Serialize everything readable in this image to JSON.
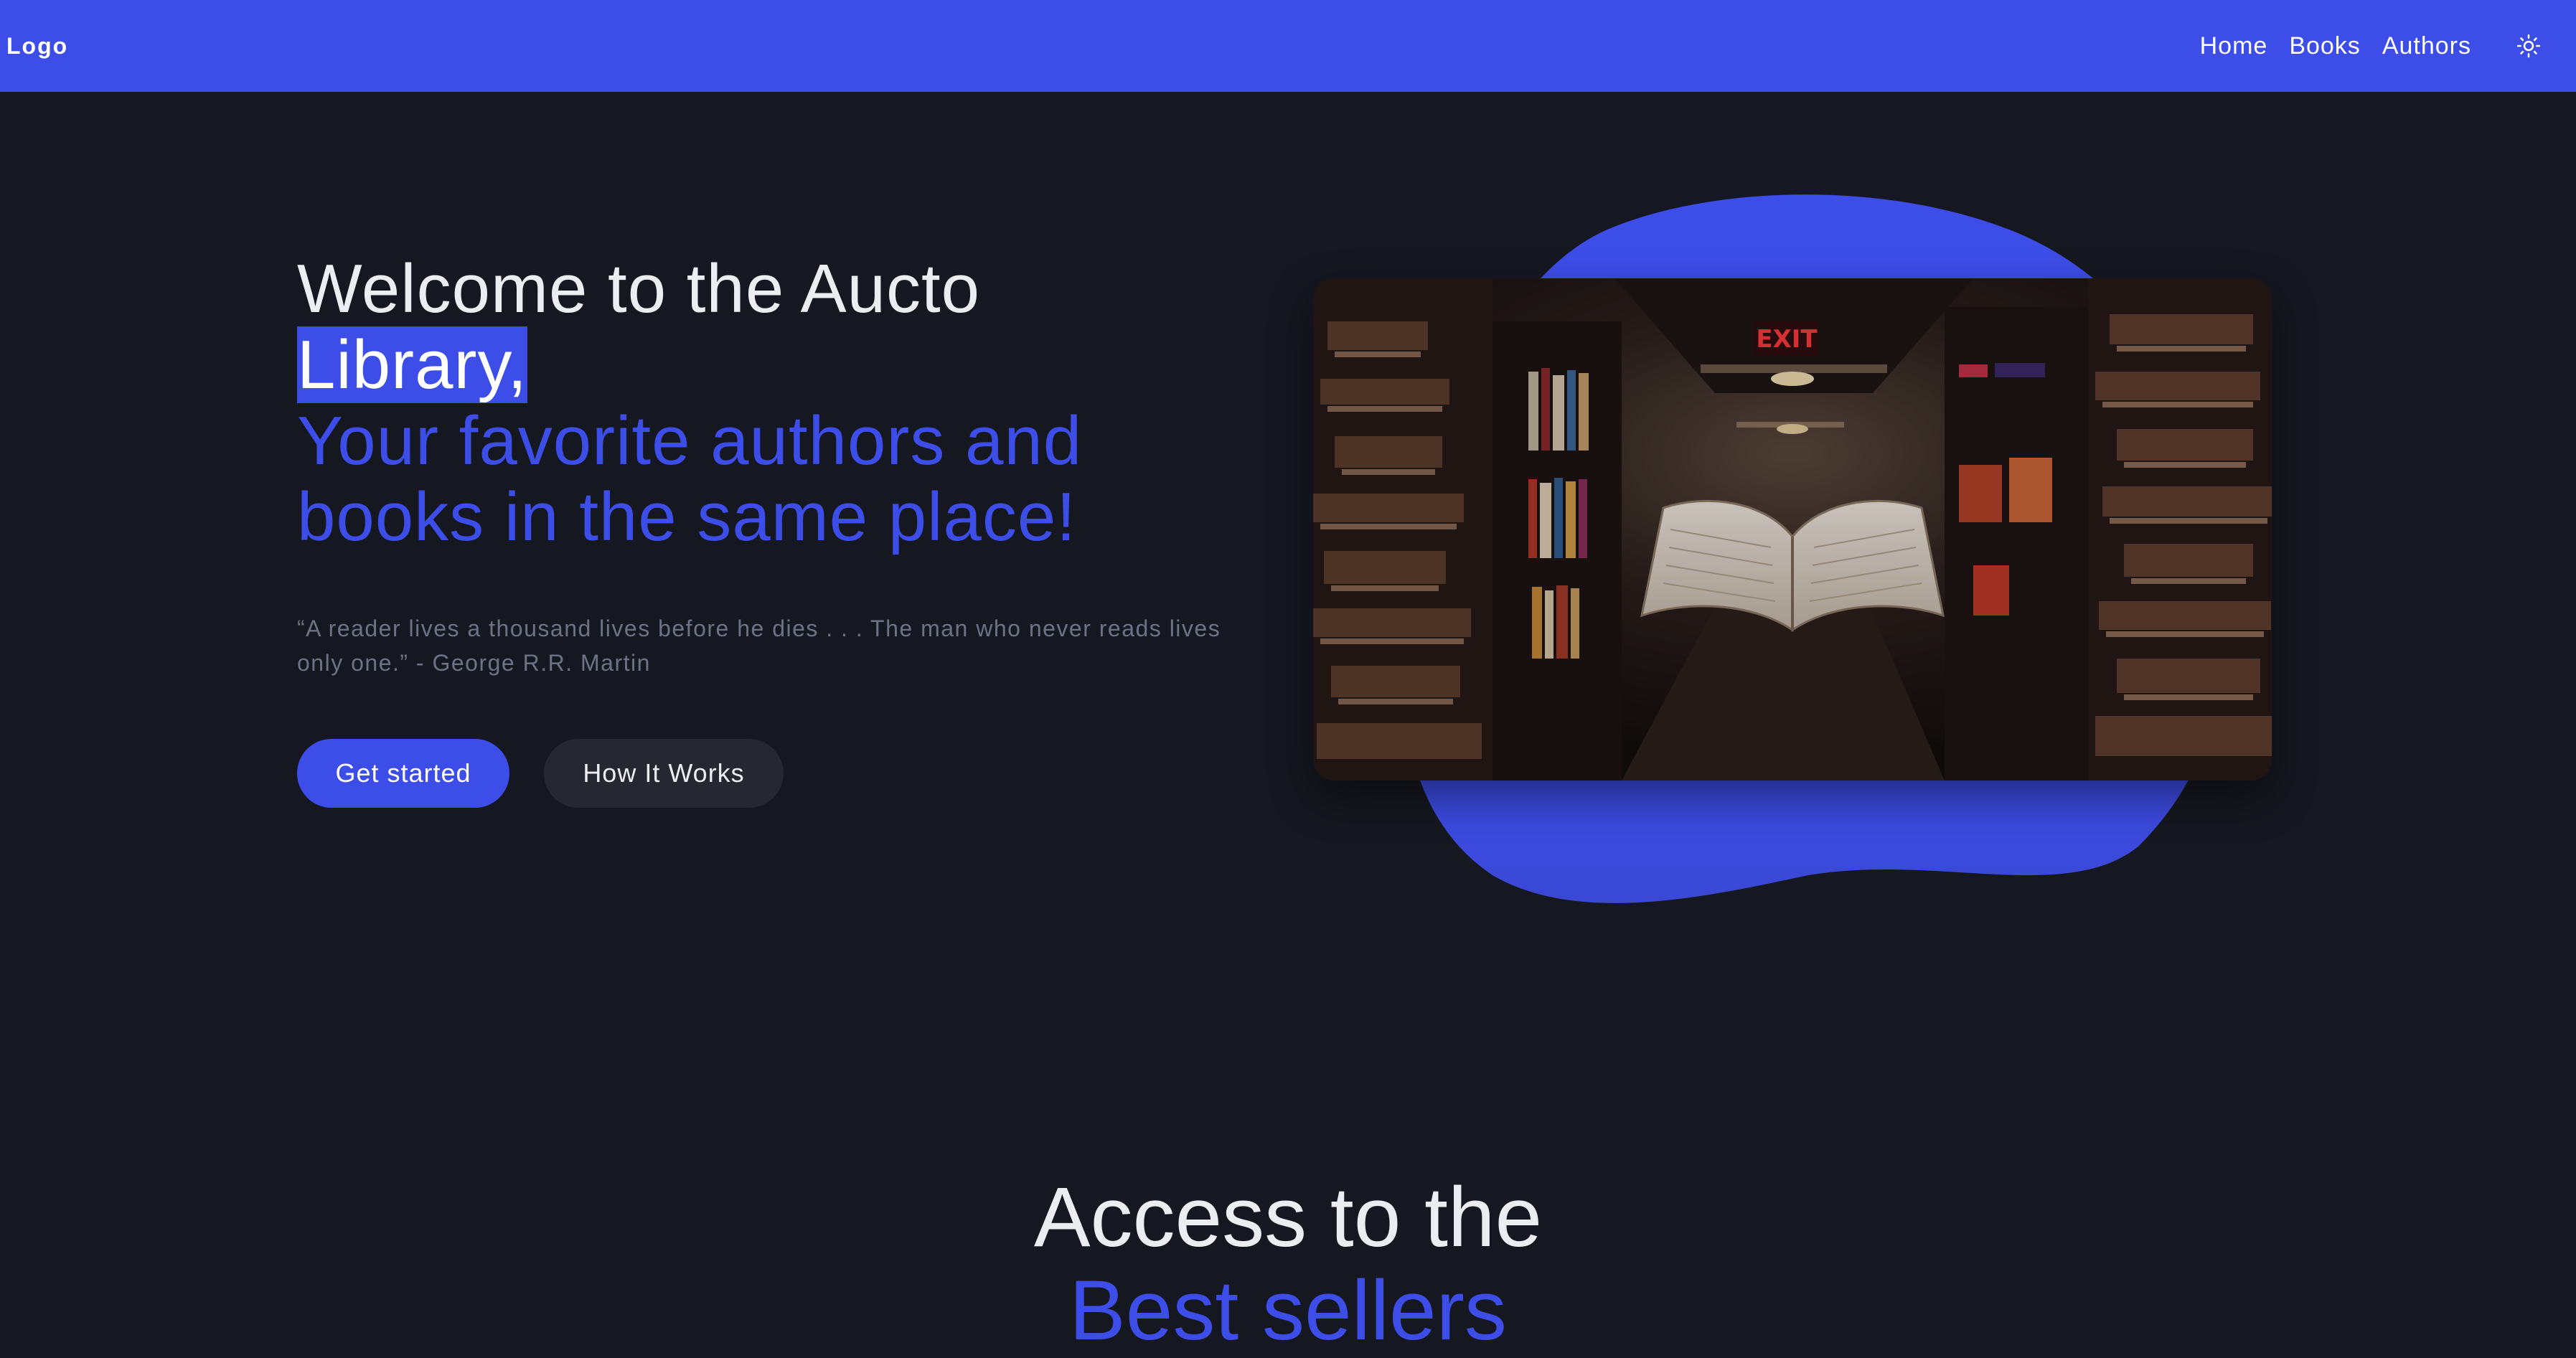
{
  "navbar": {
    "logo": "Logo",
    "links": [
      "Home",
      "Books",
      "Authors"
    ],
    "theme_icon": "sun-icon"
  },
  "hero": {
    "title_line1": "Welcome to the Aucto",
    "title_highlight": "Library,",
    "subtitle_line1": "Your favorite authors and",
    "subtitle_line2": "books in the same place!",
    "quote": "“A reader lives a thousand lives before he dies . . . The man who never reads lives only one.” - George R.R. Martin",
    "buttons": {
      "primary": "Get started",
      "secondary": "How It Works"
    },
    "image": {
      "description_icon": "floating-book-library-image",
      "sign_text": "EXIT"
    }
  },
  "section": {
    "title_line1": "Access to the",
    "title_accent": "Best sellers"
  },
  "colors": {
    "accent": "#3d4de8",
    "background": "#161821",
    "button_secondary": "#252731",
    "muted_text": "#6d7385",
    "heading_text": "#ecedf0"
  }
}
